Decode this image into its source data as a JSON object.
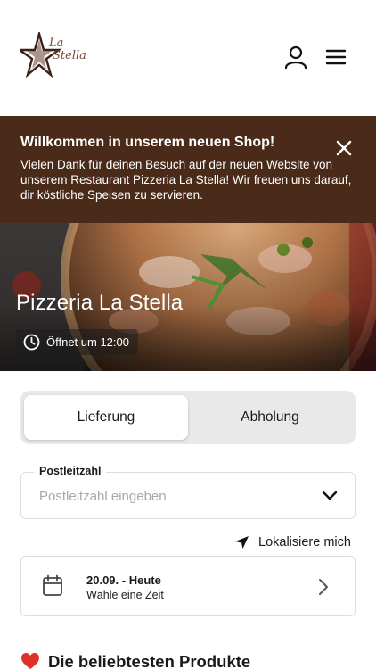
{
  "header": {
    "logo_line1": "La",
    "logo_line2": "Stella",
    "icons": {
      "account": "user-icon",
      "menu": "hamburger-menu-icon"
    }
  },
  "banner": {
    "title": "Willkommen in unserem neuen Shop!",
    "text": "Vielen Dank für deinen Besuch auf der neuen Website von unserem Restaurant Pizzeria La Stella! Wir freuen uns darauf, dir köstliche Speisen zu servieren.",
    "background": "#4a2a18"
  },
  "hero": {
    "title": "Pizzeria La Stella",
    "hours": "Öffnet um 12:00"
  },
  "order_mode": {
    "options": [
      "Lieferung",
      "Abholung"
    ],
    "selected": "Lieferung"
  },
  "zip": {
    "label": "Postleitzahl",
    "placeholder": "Postleitzahl eingeben",
    "value": ""
  },
  "locate": {
    "label": "Lokalisiere mich"
  },
  "time": {
    "date": "20.09. - Heute",
    "prompt": "Wähle eine Zeit"
  },
  "popular": {
    "title": "Die beliebtesten Produkte"
  },
  "colors": {
    "banner": "#4a2a18",
    "toggle_bg": "#e9e9e9",
    "heart": "#e0302a"
  }
}
